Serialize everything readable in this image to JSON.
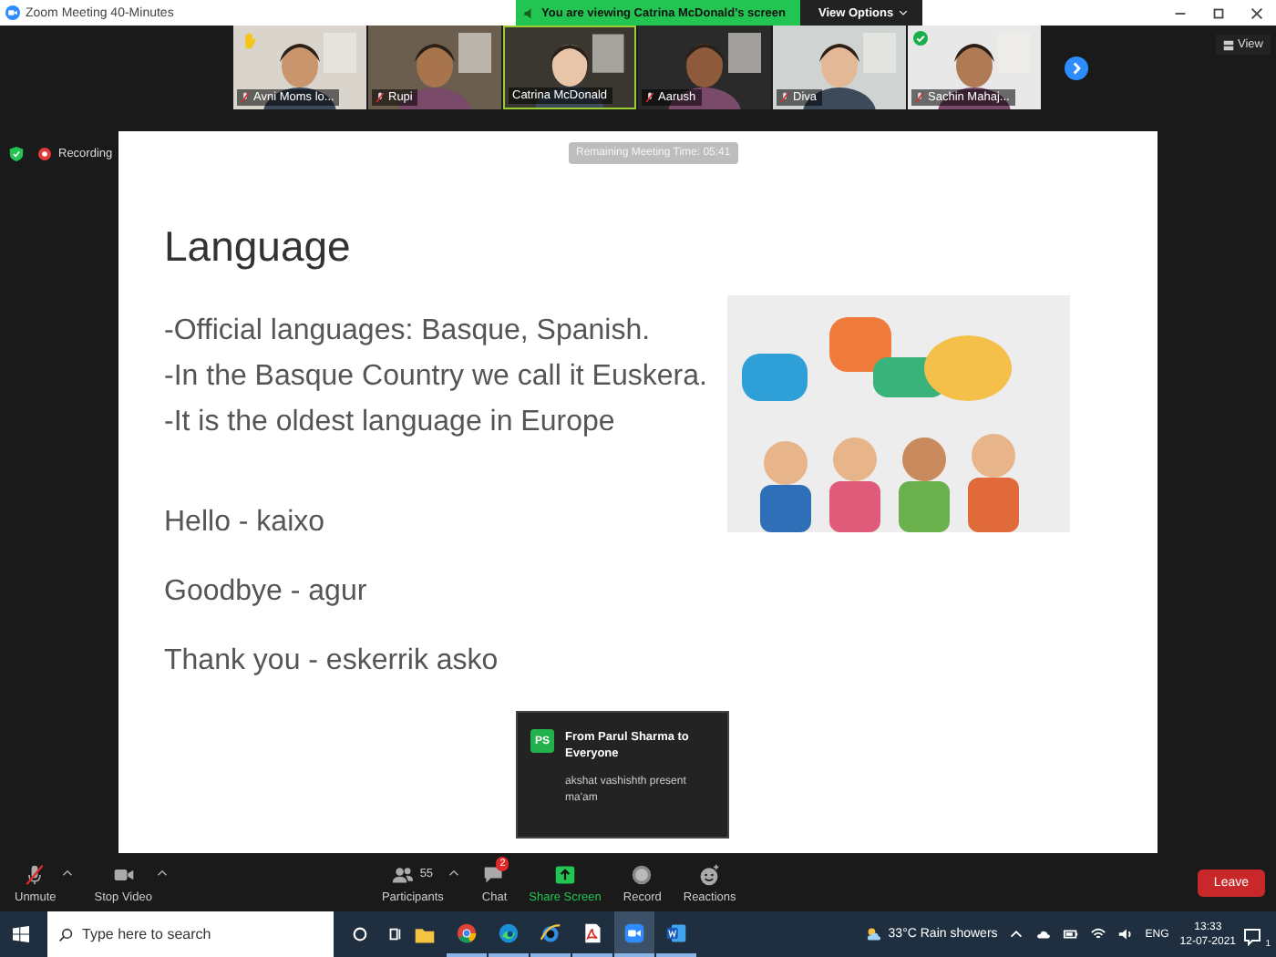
{
  "window": {
    "title": "Zoom Meeting 40-Minutes"
  },
  "banner": {
    "text": "You are viewing Catrina McDonald's screen",
    "options": "View Options"
  },
  "participants": [
    {
      "name": "Avni Moms lo...",
      "muted": true,
      "hand": true,
      "check": false,
      "selected": false
    },
    {
      "name": "Rupi",
      "muted": true,
      "hand": false,
      "check": false,
      "selected": false
    },
    {
      "name": "Catrina McDonald",
      "muted": false,
      "hand": false,
      "check": false,
      "selected": true
    },
    {
      "name": "Aarush",
      "muted": true,
      "hand": false,
      "check": false,
      "selected": false
    },
    {
      "name": "Diva",
      "muted": true,
      "hand": false,
      "check": false,
      "selected": false
    },
    {
      "name": "Sachin Mahaj...",
      "muted": true,
      "hand": false,
      "check": true,
      "selected": false
    }
  ],
  "view_button": "View",
  "recording": "Recording",
  "timer": "Remaining Meeting Time: 05:41",
  "slide": {
    "title": "Language",
    "bullets": [
      "-Official languages: Basque, Spanish.",
      "-In the Basque Country we call it Euskera.",
      "-It is the oldest language in Europe"
    ],
    "phrases": [
      "Hello - kaixo",
      "Goodbye  - agur",
      "Thank you - eskerrik asko"
    ]
  },
  "chat_popup": {
    "initials": "PS",
    "from": "From Parul Sharma to Everyone",
    "message": "akshat vashishth present ma'am"
  },
  "toolbar": [
    {
      "kind": "mic",
      "label": "Unmute",
      "caret": true
    },
    {
      "kind": "video",
      "label": "Stop Video",
      "caret": true
    },
    {
      "kind": "participants",
      "label": "Participants",
      "count": "55",
      "caret": true
    },
    {
      "kind": "chat",
      "label": "Chat",
      "badge": "2",
      "caret": false
    },
    {
      "kind": "share",
      "label": "Share Screen",
      "caret": false
    },
    {
      "kind": "record",
      "label": "Record",
      "caret": false
    },
    {
      "kind": "reactions",
      "label": "Reactions",
      "caret": false
    }
  ],
  "leave": "Leave",
  "taskbar": {
    "search_placeholder": "Type here to search",
    "apps": [
      {
        "kind": "folder",
        "open": false,
        "selected": false
      },
      {
        "kind": "chrome",
        "open": true,
        "selected": false
      },
      {
        "kind": "edge",
        "open": true,
        "selected": false
      },
      {
        "kind": "ie",
        "open": true,
        "selected": false
      },
      {
        "kind": "pdf",
        "open": true,
        "selected": false
      },
      {
        "kind": "zoom",
        "open": true,
        "selected": true
      },
      {
        "kind": "word",
        "open": true,
        "selected": false
      }
    ],
    "weather": "33°C  Rain showers",
    "language": "ENG",
    "time": "13:33",
    "date": "12-07-2021",
    "notifications": "1"
  }
}
